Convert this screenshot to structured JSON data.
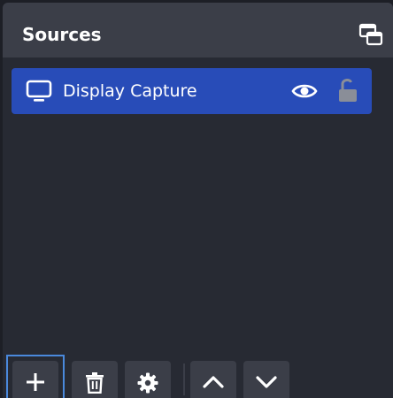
{
  "dock": {
    "title": "Sources",
    "float_icon": "undock-windows-icon"
  },
  "sources": [
    {
      "label": "Display Capture",
      "icon": "monitor-icon",
      "visible": true,
      "locked": false,
      "selected": true
    }
  ],
  "toolbar": {
    "buttons": [
      {
        "name": "add-source-button",
        "icon": "plus-icon"
      },
      {
        "name": "remove-source-button",
        "icon": "trash-icon"
      },
      {
        "name": "source-properties-button",
        "icon": "gear-icon"
      },
      {
        "name": "move-source-up-button",
        "icon": "chevron-up-icon"
      },
      {
        "name": "move-source-down-button",
        "icon": "chevron-down-icon"
      }
    ],
    "focused": "add-source-button"
  },
  "colors": {
    "panel": "#272a33",
    "header": "#3b3e48",
    "selection": "#284cb8",
    "focus": "#4a89dc",
    "icon": "#ffffff",
    "lock_icon": "#8a8e98"
  }
}
